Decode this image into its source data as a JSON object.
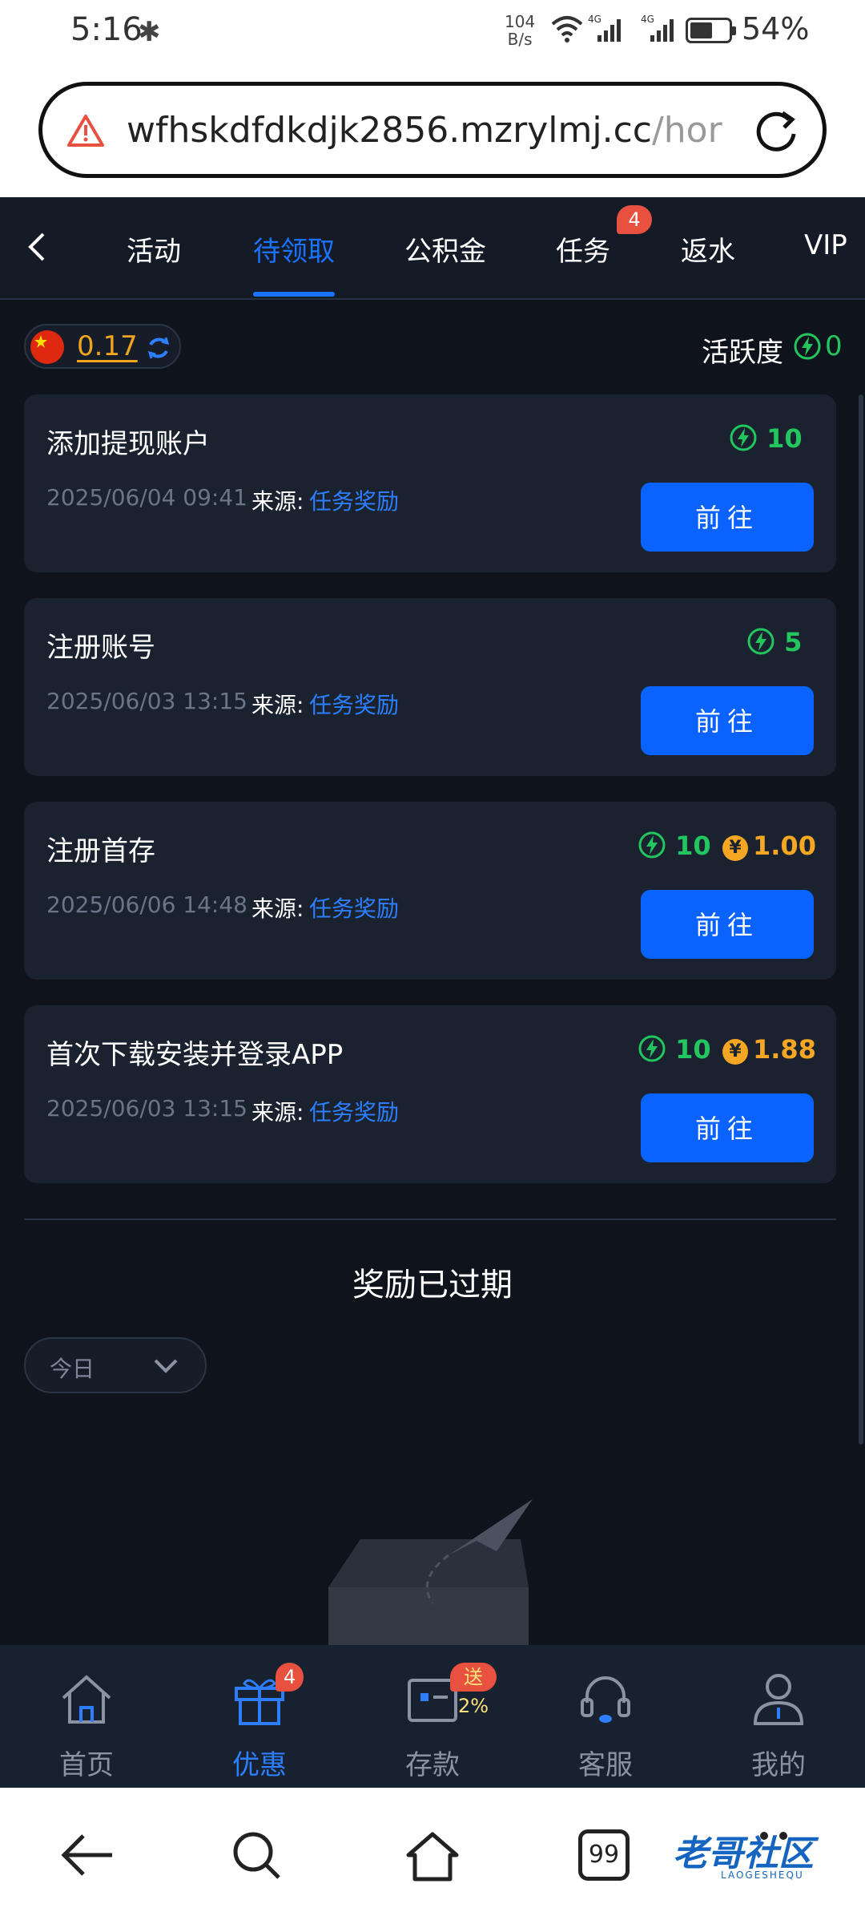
{
  "status_bar": {
    "time": "5:16",
    "net_speed_value": "104",
    "net_speed_unit": "B/s",
    "signal1": "4G",
    "signal2": "4G",
    "battery": "54%"
  },
  "browser": {
    "url_main": "wfhskdfdkdjk2856.mzrylmj.cc",
    "url_tail": "/hor"
  },
  "tabs": {
    "items": [
      "活动",
      "待领取",
      "公积金",
      "任务",
      "返水",
      "VIP"
    ],
    "active_index": 1,
    "task_badge": "4"
  },
  "summary": {
    "balance": "0.17",
    "activity_label": "活跃度",
    "activity_value": "0"
  },
  "rewards": [
    {
      "title": "添加提现账户",
      "date": "2025/06/04 09:41",
      "source_label": "来源:",
      "source": "任务奖励",
      "points": "10",
      "cash": "",
      "button": "前往"
    },
    {
      "title": "注册账号",
      "date": "2025/06/03 13:15",
      "source_label": "来源:",
      "source": "任务奖励",
      "points": "5",
      "cash": "",
      "button": "前往"
    },
    {
      "title": "注册首存",
      "date": "2025/06/06 14:48",
      "source_label": "来源:",
      "source": "任务奖励",
      "points": "10",
      "cash": "1.00",
      "button": "前往"
    },
    {
      "title": "首次下载安装并登录APP",
      "date": "2025/06/03 13:15",
      "source_label": "来源:",
      "source": "任务奖励",
      "points": "10",
      "cash": "1.88",
      "button": "前往"
    }
  ],
  "expired": {
    "title": "奖励已过期",
    "date_filter": "今日"
  },
  "bottom_nav": {
    "items": [
      "首页",
      "优惠",
      "存款",
      "客服",
      "我的"
    ],
    "active_index": 1,
    "promo_badge": "4",
    "deposit_badge": "送2%"
  },
  "system_nav": {
    "tabs_count": "99"
  },
  "watermark": {
    "text": "老哥社区",
    "sub": "LAOGESHEQU"
  },
  "colors": {
    "accent": "#1a73ff",
    "button": "#0a62ff",
    "green": "#22c55e",
    "gold": "#f5a623",
    "badge": "#e8503f",
    "background": "#0f141c",
    "card": "#1a2230"
  }
}
